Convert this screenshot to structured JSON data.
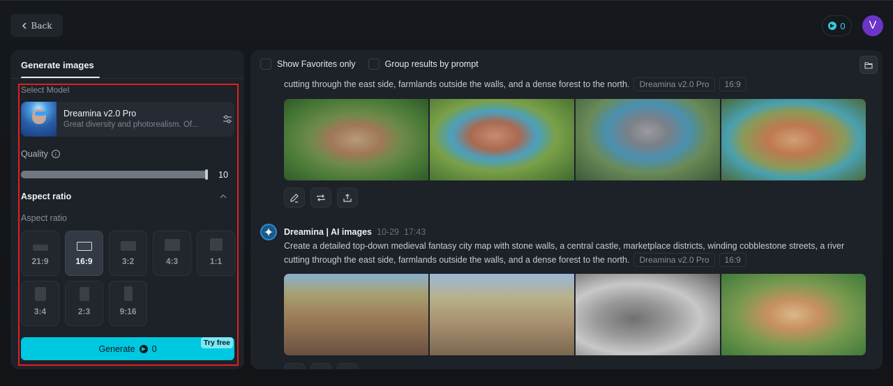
{
  "header": {
    "back_label": "Back",
    "credits": "0",
    "avatar_initial": "V"
  },
  "left_panel": {
    "tab_label": "Generate images",
    "select_model_label": "Select Model",
    "model": {
      "name": "Dreamina v2.0 Pro",
      "description": "Great diversity and photorealism. Of..."
    },
    "quality": {
      "label": "Quality",
      "value": "10",
      "fraction": 1.0
    },
    "aspect_section_title": "Aspect ratio",
    "aspect_label": "Aspect ratio",
    "aspect_ratios": [
      {
        "label": "21:9",
        "selected": false
      },
      {
        "label": "16:9",
        "selected": true
      },
      {
        "label": "3:2",
        "selected": false
      },
      {
        "label": "4:3",
        "selected": false
      },
      {
        "label": "1:1",
        "selected": false
      },
      {
        "label": "3:4",
        "selected": false
      },
      {
        "label": "2:3",
        "selected": false
      },
      {
        "label": "9:16",
        "selected": false
      }
    ],
    "generate_label": "Generate",
    "generate_cost": "0",
    "try_free_label": "Try free"
  },
  "right_panel": {
    "show_favorites_label": "Show Favorites only",
    "group_results_label": "Group results by prompt",
    "posts": [
      {
        "prompt_partial": "cutting through the east side, farmlands outside the walls, and a dense forest to the north.",
        "model_tag": "Dreamina v2.0 Pro",
        "ratio_tag": "16:9",
        "images": [
          "medieval-city-1",
          "medieval-city-2",
          "medieval-city-3",
          "medieval-city-4"
        ]
      },
      {
        "author": "Dreamina | AI images",
        "date": "10-29",
        "time": "17:43",
        "prompt_line1": "Create a detailed top-down medieval fantasy city map with stone walls, a central castle, marketplace districts, winding cobblestone streets, a river",
        "prompt_line2": "cutting through the east side, farmlands outside the walls, and a dense forest to the north.",
        "model_tag": "Dreamina v2.0 Pro",
        "ratio_tag": "16:9",
        "images": [
          "medieval-city-5",
          "medieval-city-6",
          "medieval-city-7-sketch",
          "medieval-city-8"
        ]
      }
    ],
    "actions": [
      "edit-icon",
      "regenerate-icon",
      "export-icon"
    ]
  }
}
